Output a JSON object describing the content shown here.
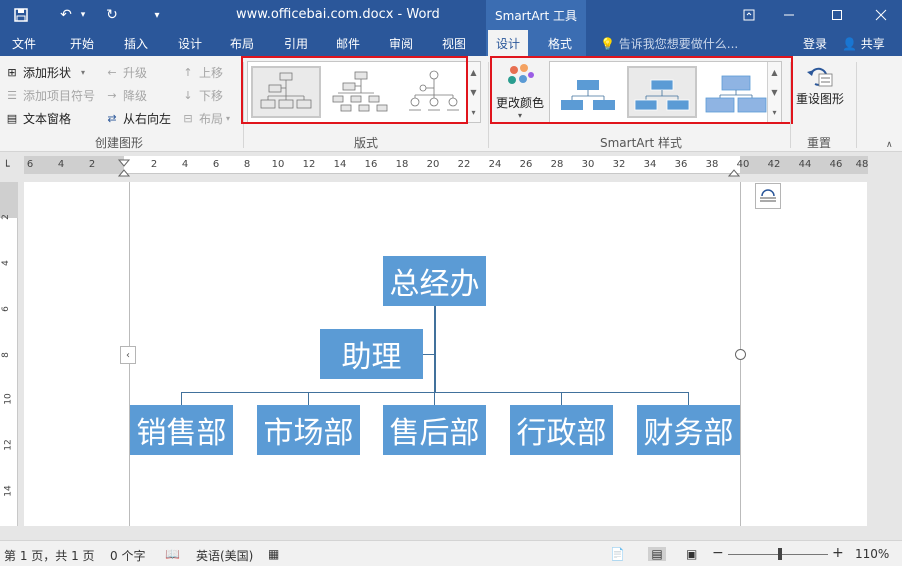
{
  "window": {
    "title": "www.officebai.com.docx - Word",
    "context_title": "SmartArt 工具",
    "quick_access": {
      "undo_dropdown": "▾",
      "customize": "▾"
    }
  },
  "tabs": [
    "文件",
    "开始",
    "插入",
    "设计",
    "布局",
    "引用",
    "邮件",
    "审阅",
    "视图",
    "设计",
    "格式"
  ],
  "tell_me": "告诉我您想要做什么...",
  "account": {
    "login": "登录",
    "share": "共享"
  },
  "ribbon": {
    "create_graphic": {
      "label": "创建图形",
      "add_shape": "添加形状",
      "add_bullet": "添加项目符号",
      "text_pane": "文本窗格",
      "promote": "升级",
      "demote": "降级",
      "right_to_left": "从右向左",
      "move_up": "上移",
      "move_down": "下移",
      "layout": "布局"
    },
    "layouts": {
      "label": "版式"
    },
    "styles": {
      "label": "SmartArt 样式",
      "change_colors": "更改颜色"
    },
    "reset": {
      "label": "重置",
      "reset_graphic": "重设图形"
    }
  },
  "ruler": {
    "h_ticks": [
      "6",
      "4",
      "2",
      "2",
      "4",
      "6",
      "8",
      "10",
      "12",
      "14",
      "16",
      "18",
      "20",
      "22",
      "24",
      "26",
      "28",
      "30",
      "32",
      "34",
      "36",
      "38",
      "40",
      "42",
      "44",
      "46",
      "48"
    ],
    "v_ticks": [
      "2",
      "4",
      "6",
      "8",
      "10",
      "12",
      "14"
    ]
  },
  "org_chart": {
    "top": "总经办",
    "assistant": "助理",
    "departments": [
      "销售部",
      "市场部",
      "售后部",
      "行政部",
      "财务部"
    ],
    "node_color": "#5b9bd5",
    "line_color": "#41719c"
  },
  "status": {
    "page": "第 1 页，共 1 页",
    "words": "0 个字",
    "language": "英语(美国)",
    "zoom": "110%"
  }
}
